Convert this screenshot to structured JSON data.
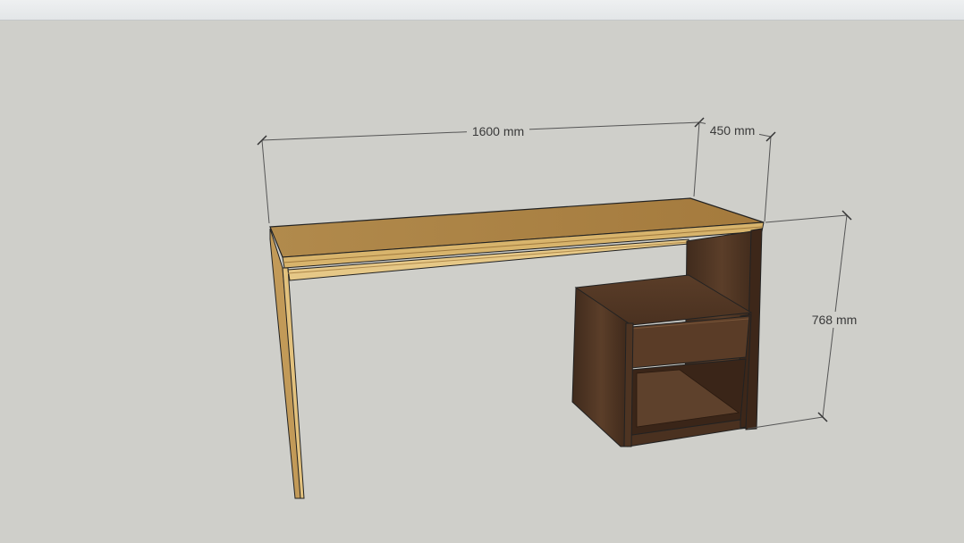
{
  "dimensions": {
    "width": "1600 mm",
    "depth": "450 mm",
    "height": "768 mm"
  },
  "colors": {
    "background": "#cfcfca",
    "desk_top": "#b58d4d",
    "desk_edge": "#d9b46b",
    "walnut_dark": "#4a3222",
    "walnut_mid": "#5e412c",
    "dimension_line": "#555555"
  }
}
